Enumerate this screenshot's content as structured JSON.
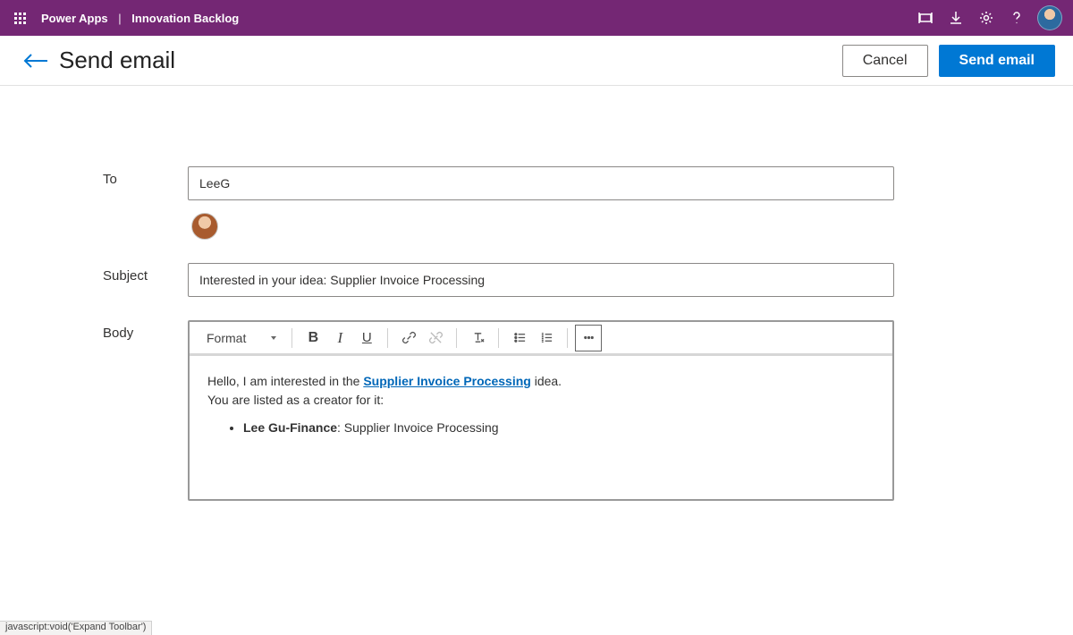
{
  "topbar": {
    "app": "Power Apps",
    "env": "Innovation Backlog"
  },
  "header": {
    "title": "Send email",
    "cancel": "Cancel",
    "send": "Send email"
  },
  "form": {
    "to_label": "To",
    "to_value": "LeeG",
    "subject_label": "Subject",
    "subject_value": "Interested in your idea: Supplier Invoice Processing",
    "body_label": "Body",
    "format_label": "Format",
    "body": {
      "line1_prefix": "Hello, I am interested in the ",
      "link_text": "Supplier Invoice Processing",
      "line1_suffix": " idea.",
      "line2": "You are listed as a creator for it:",
      "bullet_bold": "Lee Gu-Finance",
      "bullet_rest": ": Supplier Invoice Processing"
    }
  },
  "status_text": "javascript:void('Expand Toolbar')"
}
